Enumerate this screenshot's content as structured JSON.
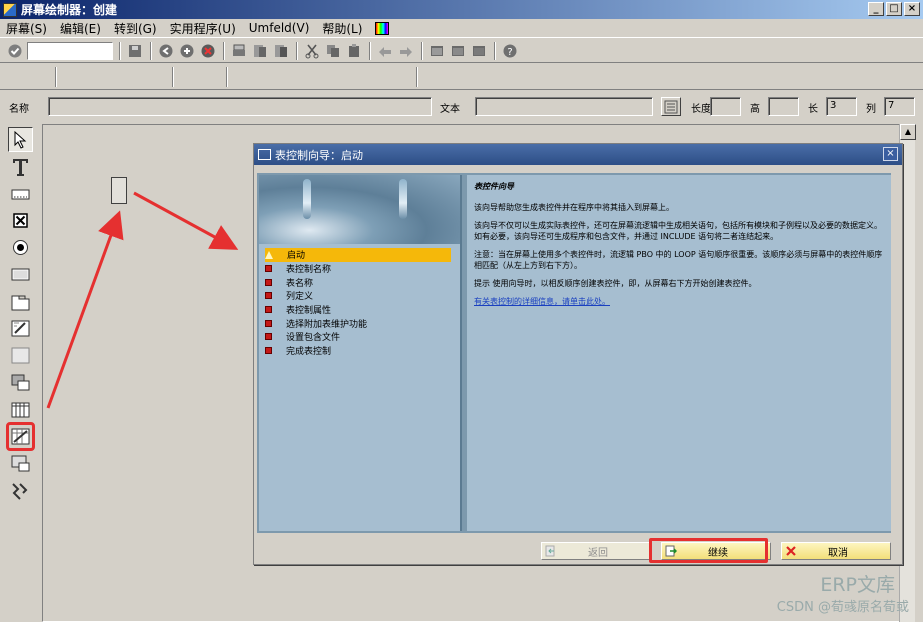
{
  "window": {
    "title": "屏幕绘制器：创建"
  },
  "menu": [
    "屏幕(S)",
    "编辑(E)",
    "转到(G)",
    "实用程序(U)",
    "Umfeld(V)",
    "帮助(L)"
  ],
  "attributes": {
    "name_label": "名称",
    "text_label": "文本",
    "height_label": "长度",
    "high_label": "高",
    "line_label": "长",
    "line_value": "3",
    "col_label": "列",
    "col_value": "7"
  },
  "dialog": {
    "title": "表控制向导：启动",
    "steps": [
      "启动",
      "表控制名称",
      "表名称",
      "列定义",
      "表控制属性",
      "选择附加表维护功能",
      "设置包含文件",
      "完成表控制"
    ],
    "heading": "表控件向导",
    "para1": "该向导帮助您生成表控件并在程序中将其插入到屏幕上。",
    "para2": "该向导不仅可以生成实际表控件，还可在屏幕流逻辑中生成相关语句，包括所有模块和子例程以及必要的数据定义。如有必要，该向导还可生成程序和包含文件，并通过 INCLUDE 语句将二者连结起来。",
    "para3": "注意：当在屏幕上使用多个表控件时，流逻辑 PBO 中的 LOOP 语句顺序很重要。该顺序必须与屏幕中的表控件顺序相匹配（从左上方到右下方）。",
    "para4": "提示 使用向导时，以相反顺序创建表控件，即，从屏幕右下方开始创建表控件。",
    "link": "有关表控制的详细信息，请单击此处。",
    "buttons": {
      "back": "返回",
      "continue": "继续",
      "cancel": "取消"
    }
  },
  "watermark": {
    "line1": "ERP文库",
    "line2": "CSDN @荀彧原名荀或"
  },
  "colors": {
    "highlight": "#e53030",
    "dialog_title": "#2d4e86",
    "active_step": "#f5b80a"
  }
}
